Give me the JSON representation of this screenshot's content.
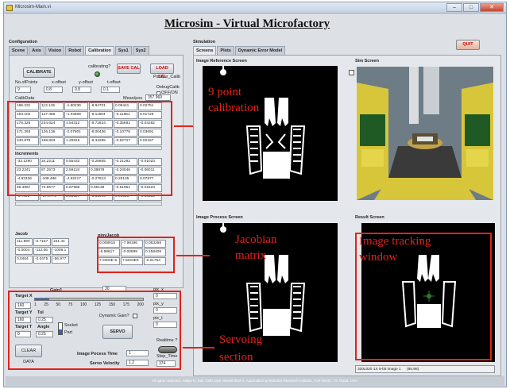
{
  "window": {
    "title": "Microsim-Main.vi"
  },
  "app_title": "Microsim - Virtual Microfactory",
  "quit_label": "QUIT",
  "config": {
    "section_label": "Configuration",
    "tabs": [
      "Scene",
      "Axis",
      "Vision",
      "Robot",
      "Calibration",
      "Sys1",
      "Sys2"
    ],
    "calibrate_label": "CALIBRATE",
    "calibrating_label": "calibrating?",
    "save_cal_label": "SAVE CAL",
    "load_cal_label": "LOAD CAL",
    "poscur_label": "PosCur_Calib",
    "fields": [
      {
        "label": "No.ofPoints",
        "value": "9"
      },
      {
        "label": "x-offset",
        "value": "0.8"
      },
      {
        "label": "y-offset",
        "value": "0.8"
      },
      {
        "label": "t-offset",
        "value": "0.1"
      }
    ],
    "debug_label": "DebugCalib",
    "debug_toggle": "OFF/ON",
    "calib_data_label": "CalibData",
    "mean_label": "Mean/pos",
    "mean_value": "357.969",
    "calib_rows": [
      [
        "186.231",
        "113.145",
        "-1.60236",
        "-8.84701",
        "0.09441",
        "0.02751"
      ],
      [
        "153.102",
        "147.366",
        "-1.04806",
        "-9.11504",
        "-0.11851",
        "0.01728"
      ],
      [
        "176.326",
        "234.624",
        "1.54312",
        "-8.72624",
        "-0.35681",
        "-0.04282"
      ],
      [
        "171.393",
        "126.136",
        "-2.07901",
        "-8.00436",
        "-0.10778",
        "0.03691"
      ],
      [
        "240.879",
        "198.803",
        "1.20815",
        "-8.34285",
        "-0.62727",
        "0.02167"
      ]
    ],
    "increments_label": "Increments",
    "incr_rows": [
      [
        "-33.1290",
        "34.2211",
        "0.55432",
        "-0.26805",
        "-0.21292",
        "-0.01023"
      ],
      [
        "23.2241",
        "87.2573",
        "2.59118",
        "0.38879",
        "-0.24046",
        "-0.06011"
      ],
      [
        "-4.93326",
        "-108.488",
        "-4.62217",
        "-0.27813",
        "0.25125",
        "0.07977"
      ],
      [
        "69.4867",
        "73.6677",
        "0.87989",
        "0.66138",
        "-0.51951",
        "-0.01523"
      ],
      [
        "-67.403",
        "-37.9776",
        "3.85627",
        "-0.56949",
        "0.96510",
        "-0.06886"
      ]
    ],
    "jacob_label": "Jacob",
    "jacob_rows": [
      [
        "111.890",
        "-0.7167",
        "151.44"
      ],
      [
        "-0.0004",
        "-112.06",
        "-1006.1"
      ],
      [
        "0.0464",
        "-0.0475",
        "-56.977"
      ]
    ],
    "pinv_label": "pinvJacob",
    "pinv_rows": [
      [
        "0.008915",
        "-7.98196",
        "0.053268"
      ],
      [
        "-6.58617",
        "-0.00899",
        "0.158408"
      ],
      [
        "7.3304E-5",
        "7.5024E5",
        "-0.01764"
      ]
    ]
  },
  "servo": {
    "gain_label": "Gain1",
    "gain_value": "30",
    "target_x_label": "Target X",
    "target_x": "160",
    "scale_ticks": [
      "1",
      "25",
      "50",
      "75",
      "100",
      "125",
      "150",
      "175",
      "200"
    ],
    "target_y_label": "Target Y",
    "target_y": "160",
    "tol_label": "Tol",
    "tol_value": "0.25",
    "target_t_label": "Target T",
    "target_t": "0",
    "angle_label": "Angle",
    "angle_value": "0.25",
    "socket_label": "Socket",
    "part_label": "Part",
    "dyn_gain_label": "Dynamic Gain?",
    "servo_btn": "SERVO",
    "clear_btn": "CLEAR DATA",
    "pix_x_label": "pix_x",
    "pix_x": "0",
    "pix_y_label": "pix_y",
    "pix_y": "0",
    "pix_t_label": "pix_t",
    "pix_t": "0",
    "realtime_label": "Realtime ?",
    "step_time_label": "Step_Time",
    "step_time": "374",
    "proc_time_label": "Image Pocess Time",
    "proc_time": "1",
    "velocity_label": "Servo Velocity",
    "velocity": "1.2"
  },
  "simulation": {
    "section_label": "Simulation",
    "tabs": [
      "Screens",
      "Plots",
      "Dynamic Error Model"
    ],
    "ref_screen_label": "Image Reference Screen",
    "sim_screen_label": "Sim Screen",
    "proc_screen_label": "Image Process Screen",
    "result_screen_label": "Result Screen",
    "status_bar": "320x320 1X 8-bit image 1",
    "status_coord": "(65,98)"
  },
  "annotations": {
    "calib": [
      "9 point",
      "calibration"
    ],
    "jacobian": [
      "Jacobian",
      "matrix"
    ],
    "tracking": [
      "Image tracking",
      "window"
    ],
    "servoing": [
      "Servoing",
      "section"
    ]
  },
  "footer": "All rights reserved, Aditya N. Das 7300 Jack Newell Blvd S, Automation & Robotics Research Institute, Fort Worth, TX 76118, USA."
}
